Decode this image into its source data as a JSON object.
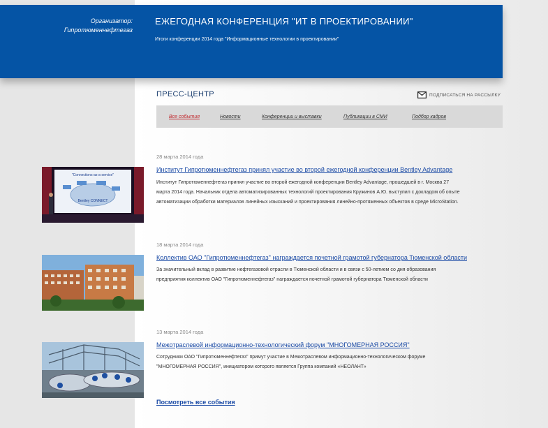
{
  "banner": {
    "organizer_label": "Организатор:",
    "organizer_name": "Гипротюменнефтегаз",
    "title": "ЕЖЕГОДНАЯ КОНФЕРЕНЦИЯ \"ИТ В ПРОЕКТИРОВАНИИ\"",
    "subtitle": "Итоги конференции 2014 года \"Информационные технологии в проектировании\""
  },
  "press": {
    "title": "ПРЕСС-ЦЕНТР",
    "subscribe_label": "ПОДПИСАТЬСЯ НА РАССЫЛКУ"
  },
  "nav": {
    "items": [
      {
        "label": "Все события",
        "active": true
      },
      {
        "label": "Новости",
        "active": false
      },
      {
        "label": "Конференции и выставки",
        "active": false
      },
      {
        "label": "Публикации в СМИ",
        "active": false
      },
      {
        "label": "Подбор кадров",
        "active": false
      }
    ]
  },
  "events": [
    {
      "date": "28 марта 2014 года",
      "title": "Институт Гипротюменнефтегаз принял участие во второй ежегодной конференции Bentley Advantage",
      "desc_lines": [
        "Институт Гипротюменнефтегаз принял участие во второй ежегодной конференции Bentley Advantage, прошедшей в г. Москва 27",
        "марта 2014 года. Начальник отдела автоматизированных технологий проектирования Кружинов А.Ю. выступил с докладом об опыте",
        "автоматизации обработки материалов линейных изысканий и проектирования линейно-протяженных объектов в среде MicroStation."
      ],
      "thumb_text": [
        "\"Connections-as-a-service\"",
        "Bentley CONNECT"
      ]
    },
    {
      "date": "18 марта 2014 года",
      "title": "Коллектив ОАО \"Гипротюменнефтегаз\" награждается почетной грамотой губернатора Тюменской области",
      "desc_lines": [
        "За значительный вклад в развитие нефтегазовой отрасли в Тюменской области и в связи с 50-летием со дня образования",
        "предприятия коллектив ОАО \"Гипротюменнефтегаз\" награждается почетной грамотой губернатора Тюменской области"
      ]
    },
    {
      "date": "13 марта 2014 года",
      "title": "Межотраслевой информационно-технологический форум \"МНОГОМЕРНАЯ РОССИЯ\"",
      "desc_lines": [
        "Сотрудники ОАО \"Гипротюменнефтегаз\" примут участие в Межотраслевом информационно-технологическом форуме",
        "\"МНОГОМЕРНАЯ РОССИЯ\", инициатором которого является Группа компаний «НЕОЛАНТ»"
      ]
    }
  ],
  "see_all_label": "Посмотреть все события",
  "colors": {
    "banner": "#0554a5",
    "link": "#1a4aa5",
    "active_nav": "#c0282d"
  }
}
